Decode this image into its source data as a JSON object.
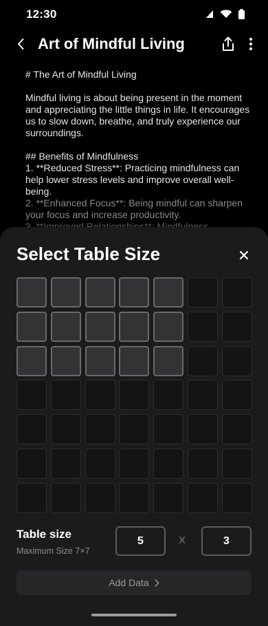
{
  "status": {
    "time": "12:30"
  },
  "header": {
    "title": "Art of Mindful Living"
  },
  "document": {
    "heading": "# The Art of Mindful Living",
    "intro": "Mindful living is about being present in the moment and appreciating the little things in life. It encourages us to slow down, breathe, and truly experience our surroundings.",
    "section_heading": "## Benefits of Mindfulness",
    "item1": "1. **Reduced Stress**: Practicing mindfulness can help lower stress levels and improve overall well-being.",
    "item2": "2. **Enhanced Focus**: Being mindful can sharpen your focus and increase productivity.",
    "item3": "3. **Improved Relationships**: Mindfulness"
  },
  "sheet": {
    "title": "Select Table Size",
    "grid": {
      "max_cols": 7,
      "max_rows": 7,
      "selected_cols": 5,
      "selected_rows": 3
    },
    "size_label": "Table size",
    "size_hint": "Maximum Size 7×7",
    "cols_value": "5",
    "rows_value": "3",
    "times": "X",
    "add_button": "Add Data"
  },
  "icons": {
    "back": "chevron-left-icon",
    "share": "share-icon",
    "more": "more-vertical-icon",
    "close": "close-icon",
    "add_arrow": "chevron-right-icon"
  }
}
